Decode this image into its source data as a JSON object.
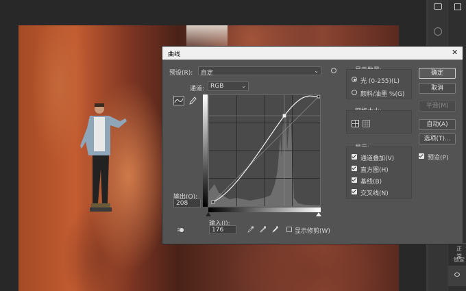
{
  "dialog": {
    "title": "曲线",
    "close": "✕",
    "preset_label": "预设(R):",
    "preset_value": "自定",
    "channel_label": "通道:",
    "channel_value": "RGB",
    "output_label": "输出(O):",
    "output_value": "208",
    "input_label": "输入(I):",
    "input_value": "176",
    "show_clipping_label": "显示修剪(W)",
    "display_amount": {
      "title": "显示数量:",
      "options": [
        {
          "label": "光 (0-255)(L)",
          "selected": true
        },
        {
          "label": "颜料/油墨 %(G)",
          "selected": false
        }
      ]
    },
    "grid_size": {
      "title": "网格大小:"
    },
    "show": {
      "title": "显示:",
      "items": [
        {
          "label": "通道叠加(V)",
          "checked": true
        },
        {
          "label": "直方图(H)",
          "checked": true
        },
        {
          "label": "基线(B)",
          "checked": true
        },
        {
          "label": "交叉线(N)",
          "checked": true
        }
      ]
    },
    "buttons": {
      "ok": "确定",
      "cancel": "取消",
      "smooth": "平滑(M)",
      "auto": "自动(A)",
      "options": "选项(T)...",
      "preview": "预览(P)"
    }
  },
  "right_panel": {
    "layer_label_1": "正常",
    "layer_label_2": "锁定"
  }
}
